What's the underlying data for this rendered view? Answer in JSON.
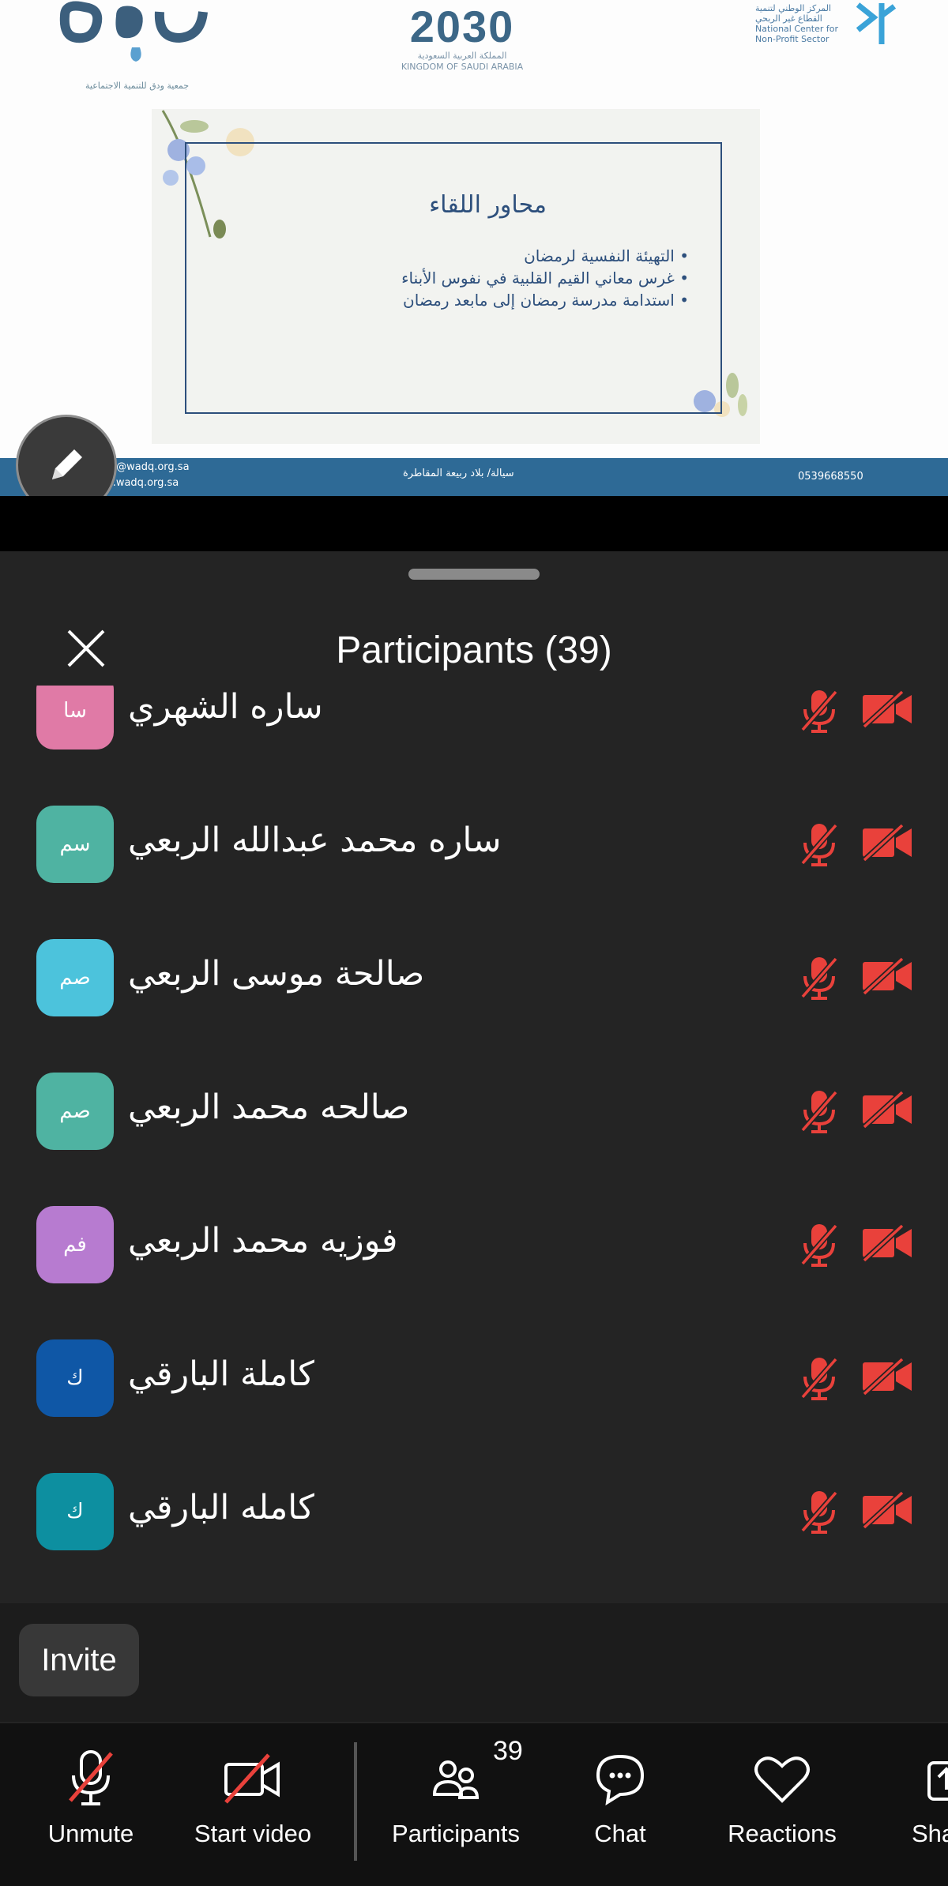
{
  "slide": {
    "logo_caption": "جمعية ودق للتنمية الاجتماعية",
    "vision_year": "2030",
    "vision_ar": "المملكة العربية السعودية",
    "vision_en": "KINGDOM OF SAUDI ARABIA",
    "ncnp_lines": [
      "المركز الوطني لتنمية",
      "القطاع غير الربحي",
      "National Center for",
      "Non-Profit Sector"
    ],
    "title": "محاور اللقاء",
    "bullets": [
      "التهيئة النفسية لرمضان",
      "غرس معاني القيم القلبية في نفوس الأبناء",
      "استدامة مدرسة رمضان إلى مابعد رمضان"
    ],
    "footer_email": "wadq@wadq.org.sa",
    "footer_web": "www.wadq.org.sa",
    "footer_location": "سيالة/ بلاد ربيعة المقاطرة",
    "footer_phone": "0539668550"
  },
  "panel": {
    "title": "Participants (39)",
    "invite_label": "Invite",
    "participants": [
      {
        "name": "ساره الشهري",
        "initials": "سا",
        "color": "#e07aa6",
        "muted": true,
        "video_off": true
      },
      {
        "name": "ساره محمد عبدالله الربعي",
        "initials": "سم",
        "color": "#4fb3a2",
        "muted": true,
        "video_off": true
      },
      {
        "name": "صالحة موسى الربعي",
        "initials": "صم",
        "color": "#4cc3dc",
        "muted": true,
        "video_off": true
      },
      {
        "name": "صالحه محمد الربعي",
        "initials": "صم",
        "color": "#4fb3a2",
        "muted": true,
        "video_off": true
      },
      {
        "name": "فوزيه محمد الربعي",
        "initials": "فم",
        "color": "#b77bd0",
        "muted": true,
        "video_off": true
      },
      {
        "name": "كاملة البارقي",
        "initials": "ك",
        "color": "#0f57a6",
        "muted": true,
        "video_off": true
      },
      {
        "name": "كامله البارقي",
        "initials": "ك",
        "color": "#0d8fa0",
        "muted": true,
        "video_off": true
      }
    ]
  },
  "toolbar": {
    "unmute": "Unmute",
    "start_video": "Start video",
    "participants": "Participants",
    "participants_count": "39",
    "chat": "Chat",
    "reactions": "Reactions",
    "share": "Sha"
  },
  "colors": {
    "muted_red": "#e9413b",
    "panel_bg": "#242424",
    "toolbar_bg": "#111111"
  }
}
